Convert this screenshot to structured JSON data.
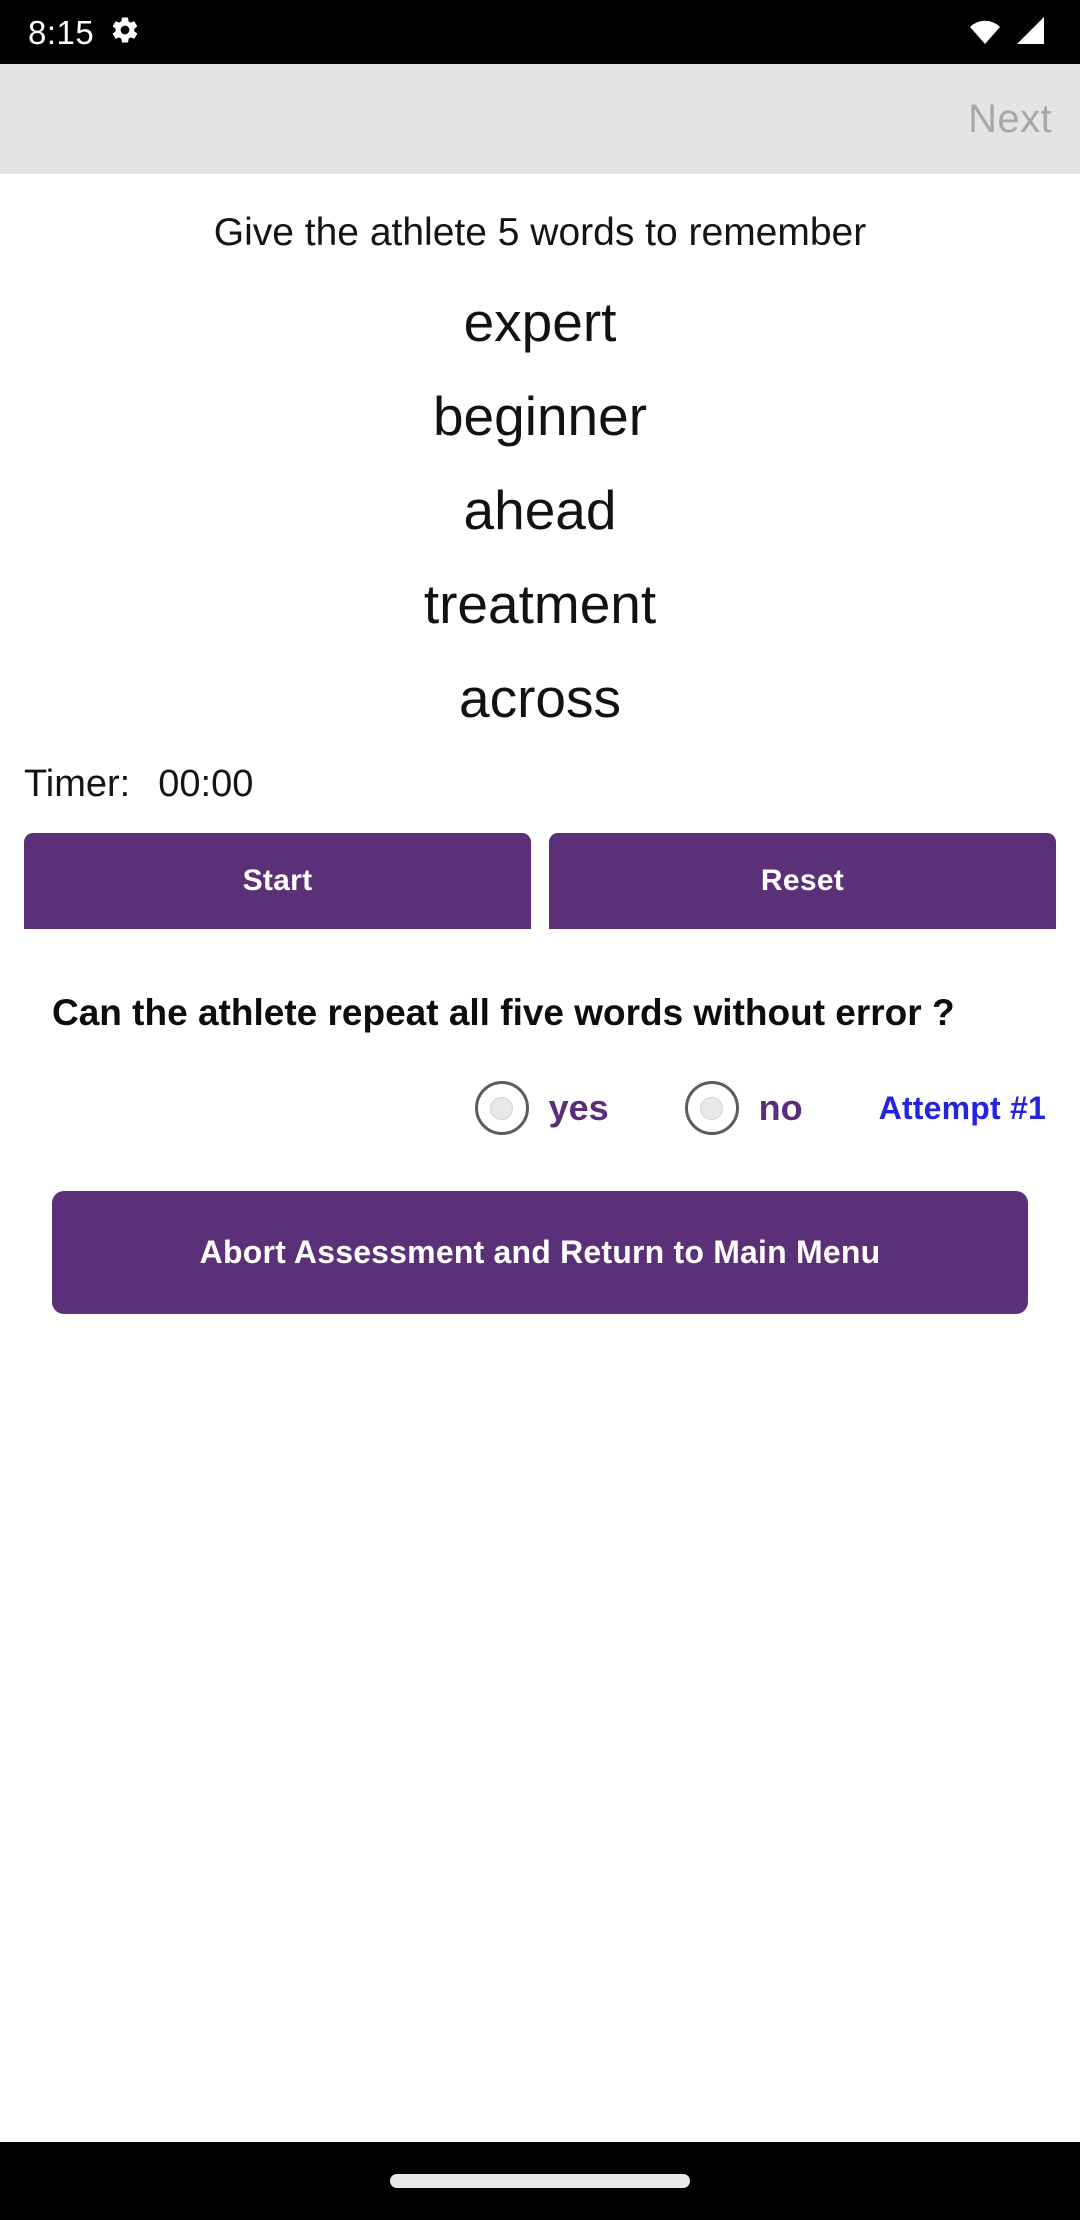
{
  "status_bar": {
    "time": "8:15",
    "icons": [
      "gear-icon",
      "wifi-icon",
      "signal-icon"
    ],
    "background": "#000000"
  },
  "app_bar": {
    "next_label": "Next",
    "next_enabled": false,
    "background": "#e4e4e4",
    "disabled_text_color": "#a8a8a8"
  },
  "main": {
    "instruction": "Give the athlete 5 words to remember",
    "words": [
      "expert",
      "beginner",
      "ahead",
      "treatment",
      "across"
    ],
    "timer": {
      "label": "Timer:",
      "value": "00:00"
    },
    "timer_buttons": [
      {
        "label": "Start",
        "name": "start-button"
      },
      {
        "label": "Reset",
        "name": "reset-button"
      }
    ],
    "question": "Can the athlete repeat all five words without error ?",
    "radio_options": [
      {
        "label": "yes",
        "value": "yes",
        "selected": false
      },
      {
        "label": "no",
        "value": "no",
        "selected": false
      }
    ],
    "attempt_badge": "Attempt #1",
    "abort_label": "Abort Assessment and Return to Main Menu"
  },
  "colors": {
    "primary_purple": "#5b3078",
    "radio_label_purple": "#5b2d78",
    "attempt_blue": "#2424e0",
    "app_bar_gray": "#e4e4e4"
  },
  "nav_bar": {
    "handle": "gesture-pill"
  }
}
